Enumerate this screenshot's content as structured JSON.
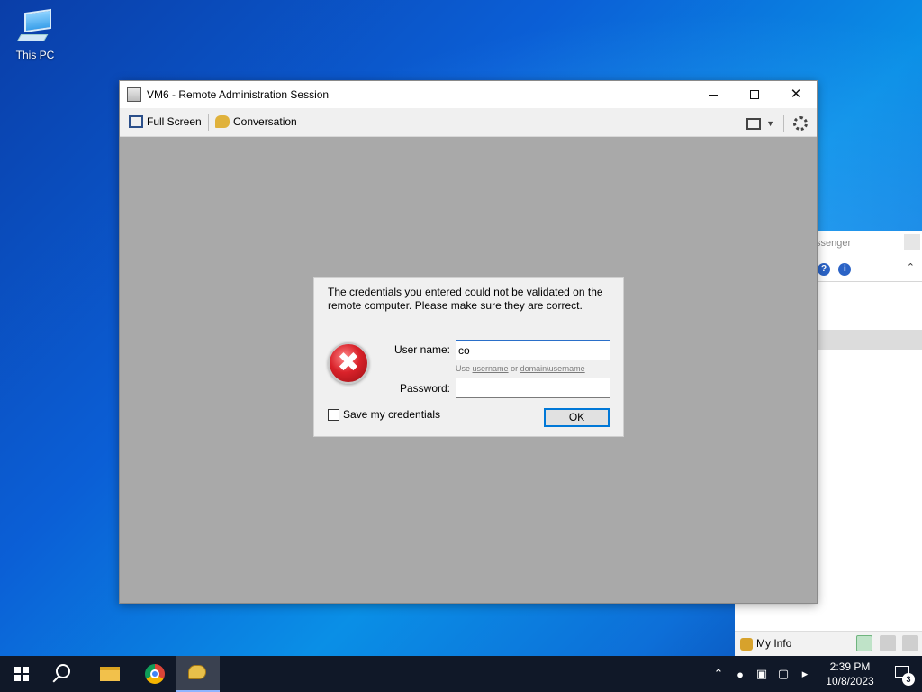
{
  "desktop": {
    "icons": [
      {
        "label": "This PC",
        "icon": "computer-icon"
      }
    ]
  },
  "window": {
    "title": "VM6 - Remote Administration Session",
    "controls": {
      "minimize": "minimize",
      "maximize": "maximize",
      "close": "close"
    },
    "toolbar": {
      "full_screen": "Full Screen",
      "conversation": "Conversation"
    }
  },
  "dialog": {
    "message": "The credentials you entered could not be validated on the remote computer. Please make sure they are correct.",
    "user_label": "User name:",
    "user_value": "co",
    "hint_prefix": "Use",
    "hint_username": "username",
    "hint_or": "or",
    "hint_domain_username": "domain\\username",
    "password_label": "Password:",
    "password_value": "",
    "save_credentials_label": "Save my credentials",
    "save_credentials_checked": false,
    "ok_label": "OK"
  },
  "messenger_panel": {
    "title_fragment": "ssenger",
    "my_info_label": "My Info"
  },
  "taskbar": {
    "apps": [
      "start",
      "search",
      "file-explorer",
      "chrome",
      "messenger"
    ],
    "clock_time": "2:39 PM",
    "clock_date": "10/8/2023",
    "notification_count": "3"
  },
  "colors": {
    "accent": "#0078d7",
    "taskbar": "#101828",
    "client_area": "#a9a9a9"
  }
}
